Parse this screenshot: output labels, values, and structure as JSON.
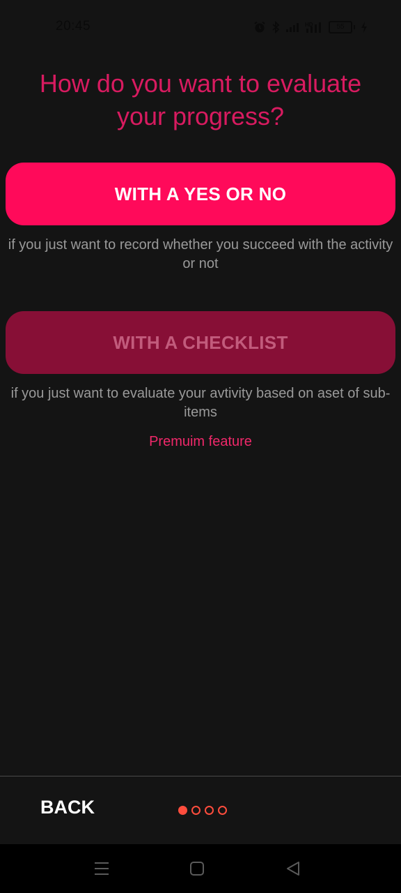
{
  "status_bar": {
    "time": "20:45",
    "battery": "55",
    "icons": [
      "alarm-icon",
      "bluetooth-icon",
      "signal-icon",
      "hd-signal-icon",
      "battery-icon",
      "charging-icon"
    ]
  },
  "heading": "How do you want to evaluate your progress?",
  "options": [
    {
      "label": "WITH A YES OR NO",
      "description": "if you just want to record whether you succeed with the activity or not"
    },
    {
      "label": "WITH A CHECKLIST",
      "description": "if you just want to evaluate your avtivity based on aset of sub-items",
      "note": "Premuim feature"
    }
  ],
  "footer": {
    "back_label": "BACK",
    "pager": {
      "total": 4,
      "current": 1
    }
  },
  "system_nav": [
    "menu-icon",
    "home-icon",
    "back-icon"
  ],
  "colors": {
    "background": "#141414",
    "accent": "#ff0a5a",
    "heading": "#d81b60",
    "disabled_button": "#870f36",
    "pager": "#ff4d3d"
  }
}
